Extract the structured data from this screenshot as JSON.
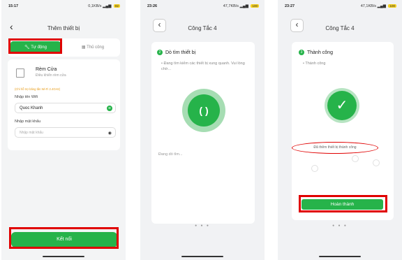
{
  "screen1": {
    "status": {
      "time": "15:17",
      "right": "0,1KB/s",
      "battery": "82"
    },
    "title": "Thêm thiết bị",
    "tabs": {
      "active": "Tự động",
      "inactive": "Thủ công"
    },
    "device": {
      "name": "Rèm Cửa",
      "desc": "Điều khiển rèm cửa"
    },
    "hint": "(Chỉ hỗ trợ băng tần Wi-Fi 2.4GHz)",
    "wifi_label": "Nhập tên Wifi",
    "wifi_value": "Quoc Khanh",
    "password_label": "Nhập mật khẩu",
    "password_placeholder": "Nhập mật khẩu",
    "connect_label": "Kết nối"
  },
  "screen2": {
    "status": {
      "time": "23:26",
      "right": "47,7KB/s",
      "battery": "100"
    },
    "title": "Công Tắc 4",
    "step_num": "2",
    "step_title": "Dò tìm thiết bị",
    "bullet": "Đang tìm kiếm các thiết bị xung quanh. Vui lòng chờ...",
    "center_glyph": "( )",
    "searching": "Đang dò tìm...",
    "pager": "● ● ●"
  },
  "screen3": {
    "status": {
      "time": "23:27",
      "right": "47,1KB/s",
      "battery": "100"
    },
    "title": "Công Tắc 4",
    "step_num": "3",
    "step_title": "Thành công",
    "bullet": "Thành công",
    "check_glyph": "✓",
    "added_text": "Đã thêm thiết bị thành công",
    "done_label": "Hoàn thành",
    "pager": "● ● ●"
  },
  "colors": {
    "accent": "#26b34a",
    "highlight": "#e00000"
  }
}
